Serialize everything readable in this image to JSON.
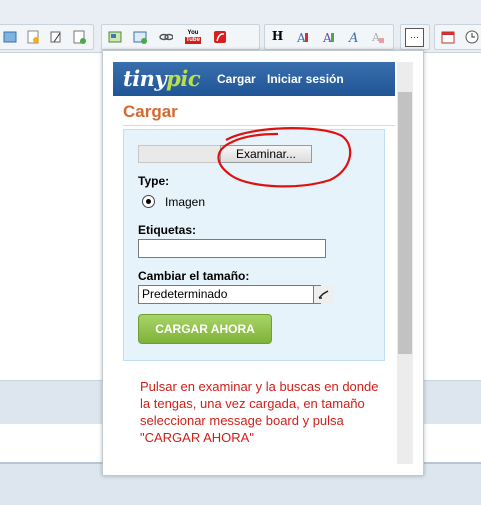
{
  "toolbar": {
    "icons": [
      "file-icon",
      "document-icon",
      "folder-icon",
      "page-icon",
      "image-icon",
      "layout-icon",
      "link-icon",
      "youtube-icon",
      "flash-icon",
      "heading-icon",
      "font-icon",
      "text-color-icon",
      "italic-a-icon",
      "clear-format-icon",
      "more-icon",
      "calendar-icon",
      "clock-icon"
    ],
    "heading_glyph": "H",
    "youtube_glyph": "You",
    "more_glyph": "···"
  },
  "popup": {
    "logo_part1": "tiny",
    "logo_part2": "pic",
    "nav_upload": "Cargar",
    "nav_login": "Iniciar sesión",
    "title": "Cargar",
    "browse_label": "Examinar...",
    "type_label": "Type:",
    "type_option": "Imagen",
    "tags_label": "Etiquetas:",
    "tags_value": "",
    "resize_label": "Cambiar el tamaño:",
    "resize_selected": "Predeterminado",
    "upload_button": "CARGAR AHORA",
    "instruction": "Pulsar en examinar y la buscas en donde la tengas, una vez cargada, en tamaño seleccionar message board y pulsa \"CARGAR AHORA\""
  },
  "colors": {
    "header_blue": "#1f5596",
    "title_orange": "#d46a32",
    "button_green": "#8fc04a",
    "annotation_red": "#e01010",
    "note_red": "#d0201a"
  }
}
